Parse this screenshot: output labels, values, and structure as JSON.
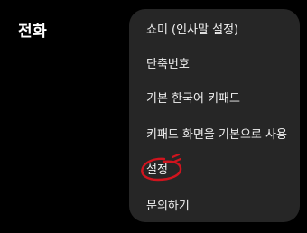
{
  "page": {
    "title": "전화"
  },
  "menu": {
    "items": [
      {
        "label": "쇼미 (인사말 설정)"
      },
      {
        "label": "단축번호"
      },
      {
        "label": "기본 한국어 키패드"
      },
      {
        "label": "키패드 화면을 기본으로 사용"
      },
      {
        "label": "설정"
      },
      {
        "label": "문의하기"
      }
    ]
  },
  "colors": {
    "background": "#000000",
    "menu_background": "#262626",
    "menu_text": "#f2f2f2",
    "annotation": "#d0141e"
  }
}
